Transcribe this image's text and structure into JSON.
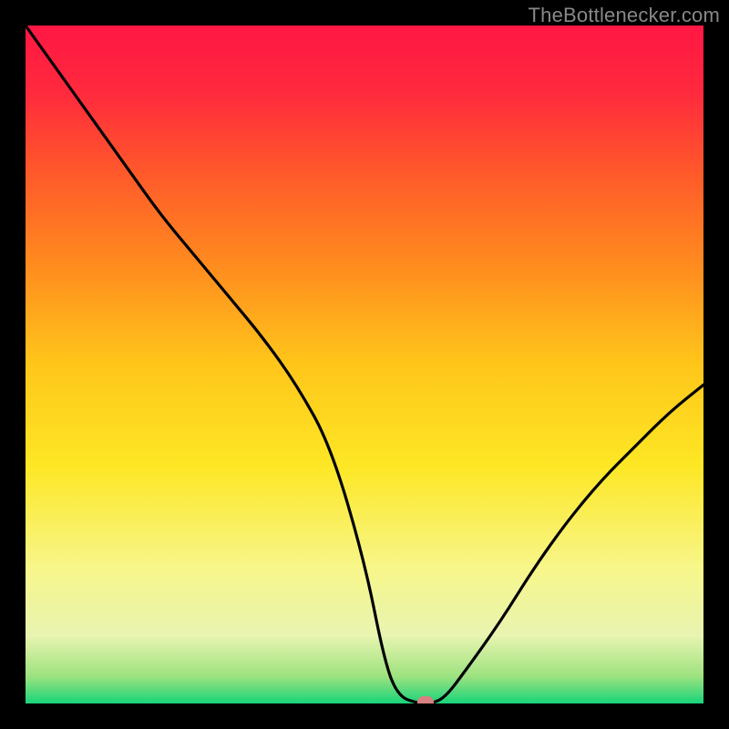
{
  "watermark": "TheBottlenecker.com",
  "chart_data": {
    "type": "line",
    "title": "",
    "xlabel": "",
    "ylabel": "",
    "xlim": [
      0,
      100
    ],
    "ylim": [
      0,
      100
    ],
    "grid": false,
    "legend": false,
    "background_gradient_stops": [
      {
        "offset": 0.0,
        "color": "#ff1744"
      },
      {
        "offset": 0.1,
        "color": "#ff2a3d"
      },
      {
        "offset": 0.22,
        "color": "#ff5a2a"
      },
      {
        "offset": 0.35,
        "color": "#ff8a1f"
      },
      {
        "offset": 0.5,
        "color": "#ffc61a"
      },
      {
        "offset": 0.65,
        "color": "#fde725"
      },
      {
        "offset": 0.8,
        "color": "#f7f68a"
      },
      {
        "offset": 0.9,
        "color": "#e8f4b0"
      },
      {
        "offset": 0.96,
        "color": "#9de27f"
      },
      {
        "offset": 1.0,
        "color": "#19d47a"
      }
    ],
    "series": [
      {
        "name": "bottleneck-curve",
        "color": "#000000",
        "x": [
          0,
          5,
          10,
          15,
          20,
          25,
          30,
          35,
          40,
          45,
          50,
          53,
          55,
          58,
          60,
          62,
          65,
          70,
          75,
          80,
          85,
          90,
          95,
          100
        ],
        "y": [
          100,
          93,
          86,
          79,
          72,
          66,
          60,
          54,
          47,
          38,
          21,
          6,
          1,
          0,
          0,
          1,
          5,
          12,
          20,
          27,
          33,
          38,
          43,
          47
        ]
      }
    ],
    "marker": {
      "x": 59,
      "y": 0,
      "color": "#d98082",
      "shape": "rounded-square"
    }
  }
}
